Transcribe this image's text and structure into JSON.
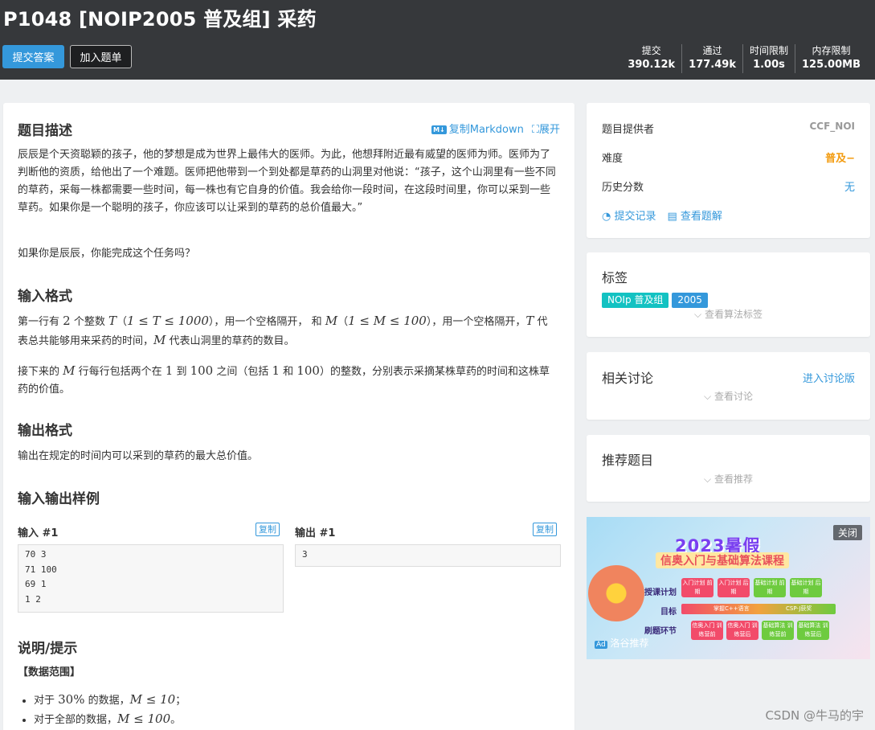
{
  "header": {
    "title": "P1048 [NOIP2005 普及组] 采药",
    "submit_label": "提交答案",
    "add_label": "加入题单",
    "stats": [
      {
        "label": "提交",
        "value": "390.12k"
      },
      {
        "label": "通过",
        "value": "177.49k"
      },
      {
        "label": "时间限制",
        "value": "1.00s"
      },
      {
        "label": "内存限制",
        "value": "125.00MB"
      }
    ]
  },
  "problem": {
    "desc_title": "题目描述",
    "copy_md": "复制Markdown",
    "expand": "展开",
    "desc_text": "辰辰是个天资聪颖的孩子，他的梦想是成为世界上最伟大的医师。为此，他想拜附近最有威望的医师为师。医师为了判断他的资质，给他出了一个难题。医师把他带到一个到处都是草药的山洞里对他说：“孩子，这个山洞里有一些不同的草药，采每一株都需要一些时间，每一株也有它自身的价值。我会给你一段时间，在这段时间里，你可以采到一些草药。如果你是一个聪明的孩子，你应该可以让采到的草药的总价值最大。”",
    "desc_q": "如果你是辰辰，你能完成这个任务吗？",
    "input_title": "输入格式",
    "input_p1": {
      "a": "第一行有 ",
      "n2": "2",
      "b": " 个整数 ",
      "c": "（",
      "c2": "），用一个空格隔开，",
      "d": " 代表总共能够用来采药的时间，",
      "e": " 代表山洞里的草药的数目。",
      "and": " 和 ",
      "T": "T",
      "M": "M",
      "cT": "1 ≤ T ≤ 1000",
      "cM": "1 ≤ M ≤ 100"
    },
    "input_p2": {
      "a": "接下来的 ",
      "M": "M",
      "b": " 行每行包括两个在 ",
      "n1": "1",
      "c": " 到 ",
      "n100": "100",
      "d": " 之间（包括 ",
      "e": " 和 ",
      "f": "）的整数，分别表示采摘某株草药的时间和这株草药的价值。"
    },
    "output_title": "输出格式",
    "output_text": "输出在规定的时间内可以采到的草药的最大总价值。",
    "sample_title": "输入输出样例",
    "in_label": "输入 #1",
    "out_label": "输出 #1",
    "copy": "复制",
    "sample_in": "70 3\n71 100\n69 1\n1 2",
    "sample_out": "3",
    "hint_title": "说明/提示",
    "range_title": "【数据范围】",
    "range1_a": "对于 ",
    "range1_pct": "30%",
    "range1_b": " 的数据，",
    "range1_m": "M ≤ 10",
    "range1_end": "；",
    "range2_a": "对于全部的数据，",
    "range2_m": "M ≤ 100",
    "range2_end": "。"
  },
  "info": {
    "provider_label": "题目提供者",
    "provider": "CCF_NOI",
    "difficulty_label": "难度",
    "difficulty": "普及−",
    "history_label": "历史分数",
    "history": "无",
    "submissions": "提交记录",
    "solutions": "查看题解"
  },
  "tags": {
    "title": "标签",
    "items": [
      "NOIp 普及组",
      "2005"
    ],
    "more": "查看算法标签"
  },
  "discuss": {
    "title": "相关讨论",
    "enter": "进入讨论版",
    "more": "查看讨论"
  },
  "recommend": {
    "title": "推荐题目",
    "more": "查看推荐"
  },
  "ad": {
    "title": "2023暑假",
    "subtitle": "信奥入门与基础算法课程",
    "close": "关闭",
    "badge": "洛谷推荐",
    "row1_label": "授课计划",
    "row2_label": "目标",
    "row3_label": "刷题环节",
    "row1": [
      "入门计划 前期",
      "入门计划 后期",
      "基础计划 前期",
      "基础计划 后期"
    ],
    "bar_left": "掌握C++语言",
    "bar_right": "CSP-J获奖",
    "row3": [
      "信奥入门 训练营前",
      "信奥入门 训练营后",
      "基础算法 训练营前",
      "基础算法 训练营后"
    ]
  },
  "watermark": "CSDN @牛马的宇",
  "colors": {
    "header_bg": "#36383b",
    "accent": "#3498db",
    "difficulty": "#f39c11",
    "tag1": "#13c2c2",
    "tag2": "#3498db"
  }
}
